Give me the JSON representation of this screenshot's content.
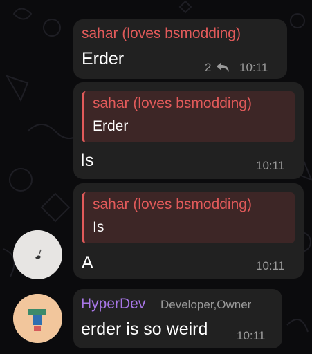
{
  "messages": [
    {
      "sender": "sahar (loves bsmodding)",
      "text": "Erder",
      "reply_count": "2",
      "time": "10:11"
    },
    {
      "reply_to": {
        "sender": "sahar (loves bsmodding)",
        "text": "Erder"
      },
      "text": "Is",
      "time": "10:11"
    },
    {
      "reply_to": {
        "sender": "sahar (loves bsmodding)",
        "text": "Is"
      },
      "text": "A",
      "time": "10:11"
    },
    {
      "sender": "HyperDev",
      "sender_color": "#a876e6",
      "role": "Developer,Owner",
      "text": "erder is so weird",
      "time": "10:11"
    }
  ],
  "icons": {
    "reply": "reply-arrow-icon"
  },
  "colors": {
    "sender_red": "#e15a5a",
    "hyperdev_purple": "#a876e6",
    "bubble": "#212121"
  }
}
